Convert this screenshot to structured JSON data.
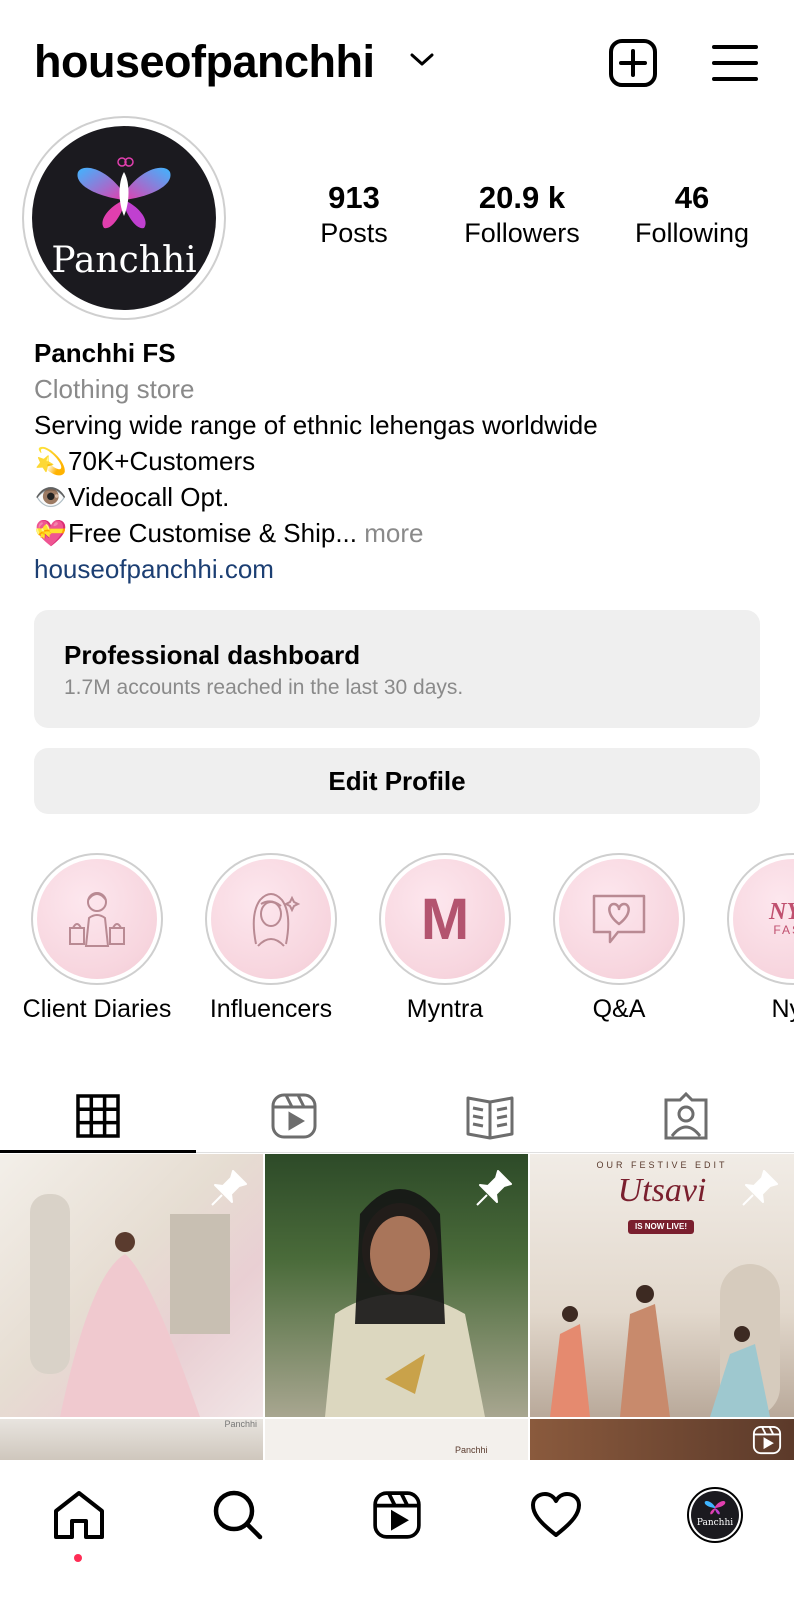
{
  "header": {
    "username": "houseofpanchhi"
  },
  "avatar": {
    "wordmark": "Panchhi"
  },
  "stats": [
    {
      "value": "913",
      "label": "Posts"
    },
    {
      "value": "20.9 k",
      "label": "Followers"
    },
    {
      "value": "46",
      "label": "Following"
    }
  ],
  "bio": {
    "name": "Panchhi FS",
    "category": "Clothing store",
    "line1": "Serving wide range of ethnic lehengas worldwide",
    "line2_emoji": "💫",
    "line2": "70K+Customers",
    "line3_emoji": "👁️",
    "line3": "Videocall Opt.",
    "line4_emoji": "💝",
    "line4": "Free Customise & Ship...",
    "more": "more",
    "link": "houseofpanchhi.com"
  },
  "dashboard": {
    "title": "Professional dashboard",
    "subtitle": "1.7M accounts reached in the last 30 days."
  },
  "edit_profile": "Edit Profile",
  "highlights": [
    {
      "label": "Client Diaries",
      "icon": "shopping-woman-icon"
    },
    {
      "label": "Influencers",
      "icon": "woman-portrait-icon"
    },
    {
      "label": "Myntra",
      "icon": "myntra-logo",
      "logo_text": "M"
    },
    {
      "label": "Q&A",
      "icon": "heart-chat-icon"
    },
    {
      "label": "Nyk",
      "icon": "nykaa-logo",
      "logo_text": "NYK",
      "logo_sub": "FASH"
    }
  ],
  "posts": [
    {
      "caption_overlay": ""
    },
    {
      "caption_overlay": ""
    },
    {
      "top_text": "OUR FESTIVE EDIT",
      "title": "Utsavi",
      "badge": "IS NOW LIVE!"
    }
  ],
  "post_row2": [
    {
      "watermark": "Panchhi"
    },
    {
      "watermark": "Panchhi"
    },
    {
      "watermark": ""
    }
  ],
  "bottom_nav": {
    "profile_wordmark": "Panchhi"
  },
  "colors": {
    "link": "#1c3f73",
    "muted": "#8a8a8a",
    "card": "#efefef",
    "notify_dot": "#ff2d55"
  }
}
